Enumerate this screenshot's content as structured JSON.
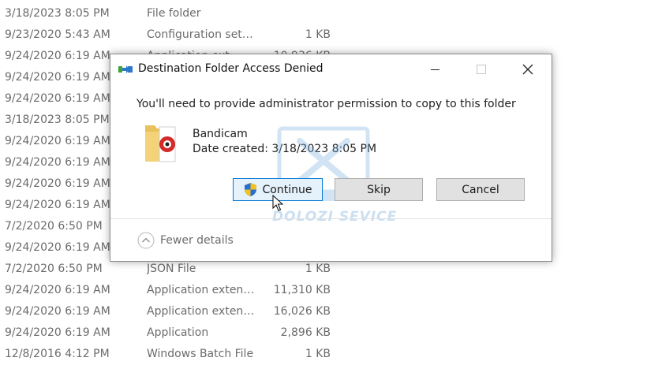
{
  "background_files": [
    {
      "date": "3/18/2023 8:05 PM",
      "type": "File folder",
      "size": ""
    },
    {
      "date": "9/23/2020 5:43 AM",
      "type": "Configuration setti...",
      "size": "1 KB"
    },
    {
      "date": "9/24/2020 6:19 AM",
      "type": "Application ext...",
      "size": "10,936 KB"
    },
    {
      "date": "9/24/2020 6:19 AM",
      "type": "",
      "size": ""
    },
    {
      "date": "9/24/2020 6:19 AM",
      "type": "",
      "size": ""
    },
    {
      "date": "3/18/2023 8:05 PM",
      "type": "",
      "size": ""
    },
    {
      "date": "9/24/2020 6:19 AM",
      "type": "",
      "size": ""
    },
    {
      "date": "9/24/2020 6:19 AM",
      "type": "",
      "size": ""
    },
    {
      "date": "9/24/2020 6:19 AM",
      "type": "",
      "size": ""
    },
    {
      "date": "9/24/2020 6:19 AM",
      "type": "",
      "size": ""
    },
    {
      "date": "7/2/2020 6:50 PM",
      "type": "",
      "size": ""
    },
    {
      "date": "9/24/2020 6:19 AM",
      "type": "",
      "size": ""
    },
    {
      "date": "7/2/2020 6:50 PM",
      "type": "JSON File",
      "size": "1 KB"
    },
    {
      "date": "9/24/2020 6:19 AM",
      "type": "Application extens...",
      "size": "11,310 KB"
    },
    {
      "date": "9/24/2020 6:19 AM",
      "type": "Application extens...",
      "size": "16,026 KB"
    },
    {
      "date": "9/24/2020 6:19 AM",
      "type": "Application",
      "size": "2,896 KB"
    },
    {
      "date": "12/8/2016 4:12 PM",
      "type": "Windows Batch File",
      "size": "1 KB"
    }
  ],
  "dialog": {
    "title": "Destination Folder Access Denied",
    "message": "You'll need to provide administrator permission to copy to this folder",
    "item_name": "Bandicam",
    "item_date": "Date created: 3/18/2023 8:05 PM",
    "buttons": {
      "continue": "Continue",
      "skip": "Skip",
      "cancel": "Cancel"
    },
    "details_toggle": "Fewer details"
  },
  "watermark": "DOLOZI SEVICE",
  "icons": {
    "title": "copy-arrow-icon",
    "item": "bandicam-folder-icon",
    "shield": "uac-shield-icon",
    "details": "chevron-up-icon",
    "window": [
      "minimize-icon",
      "maximize-icon",
      "close-icon"
    ]
  },
  "colors": {
    "accent_border": "#0078d7",
    "button_bg": "#e1e1e1",
    "focused_button_bg": "#e5f1fb",
    "background_text": "#6b6b6b"
  }
}
